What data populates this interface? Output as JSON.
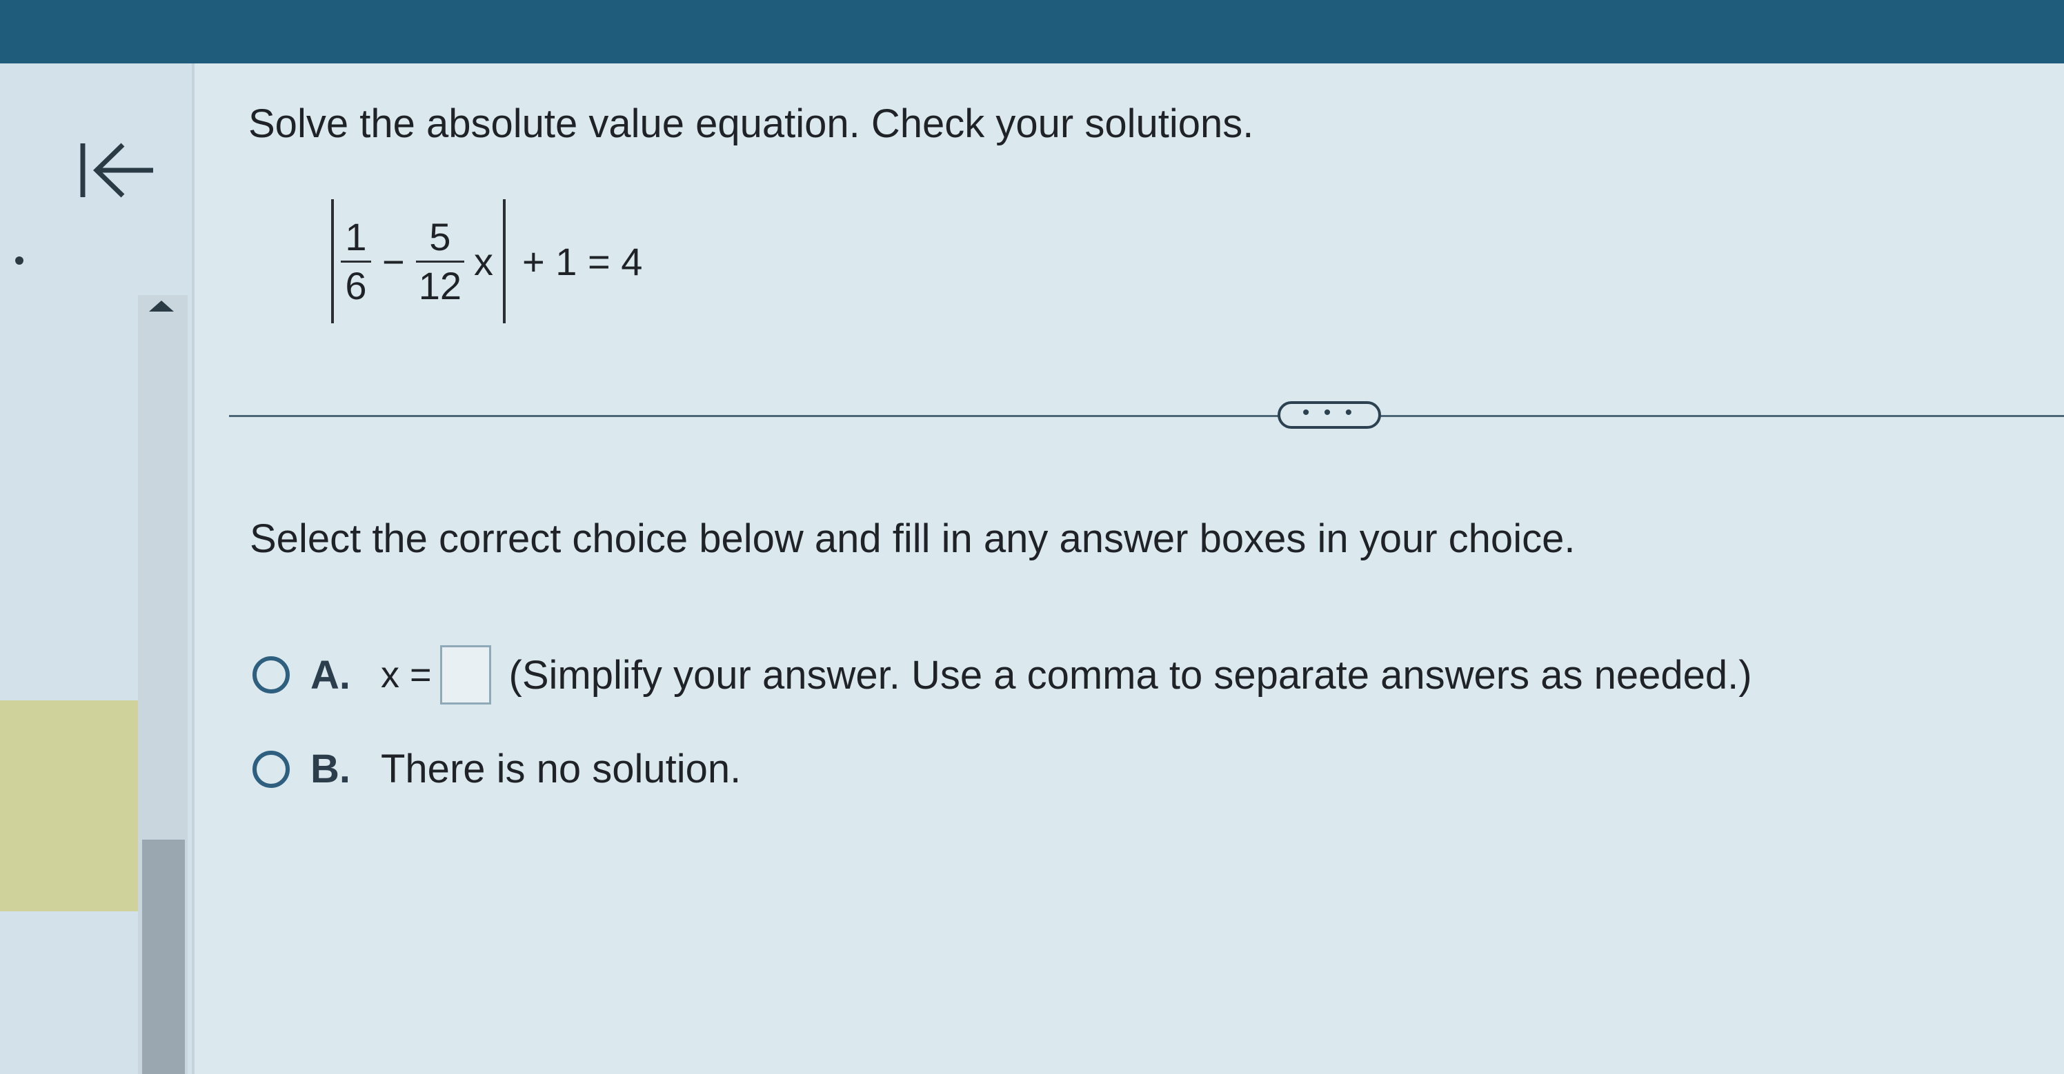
{
  "question": {
    "prompt": "Solve the absolute value equation. Check your solutions.",
    "equation": {
      "frac1_num": "1",
      "frac1_den": "6",
      "minus": "−",
      "frac2_num": "5",
      "frac2_den": "12",
      "variable": "x",
      "rhs": "+ 1 = 4"
    }
  },
  "more_button_label": "• • •",
  "instruction": "Select the correct choice below and fill in any answer boxes in your choice.",
  "choices": [
    {
      "letter": "A.",
      "prefix": "x =",
      "text": "(Simplify your answer. Use a comma to separate answers as needed.)"
    },
    {
      "letter": "B.",
      "text": "There is no solution."
    }
  ],
  "colors": {
    "header": "#1f5b7a",
    "accent": "#2f5f7e"
  },
  "icons": {
    "back": "back-to-start-arrow-icon",
    "scroll_up": "triangle-up-icon"
  }
}
